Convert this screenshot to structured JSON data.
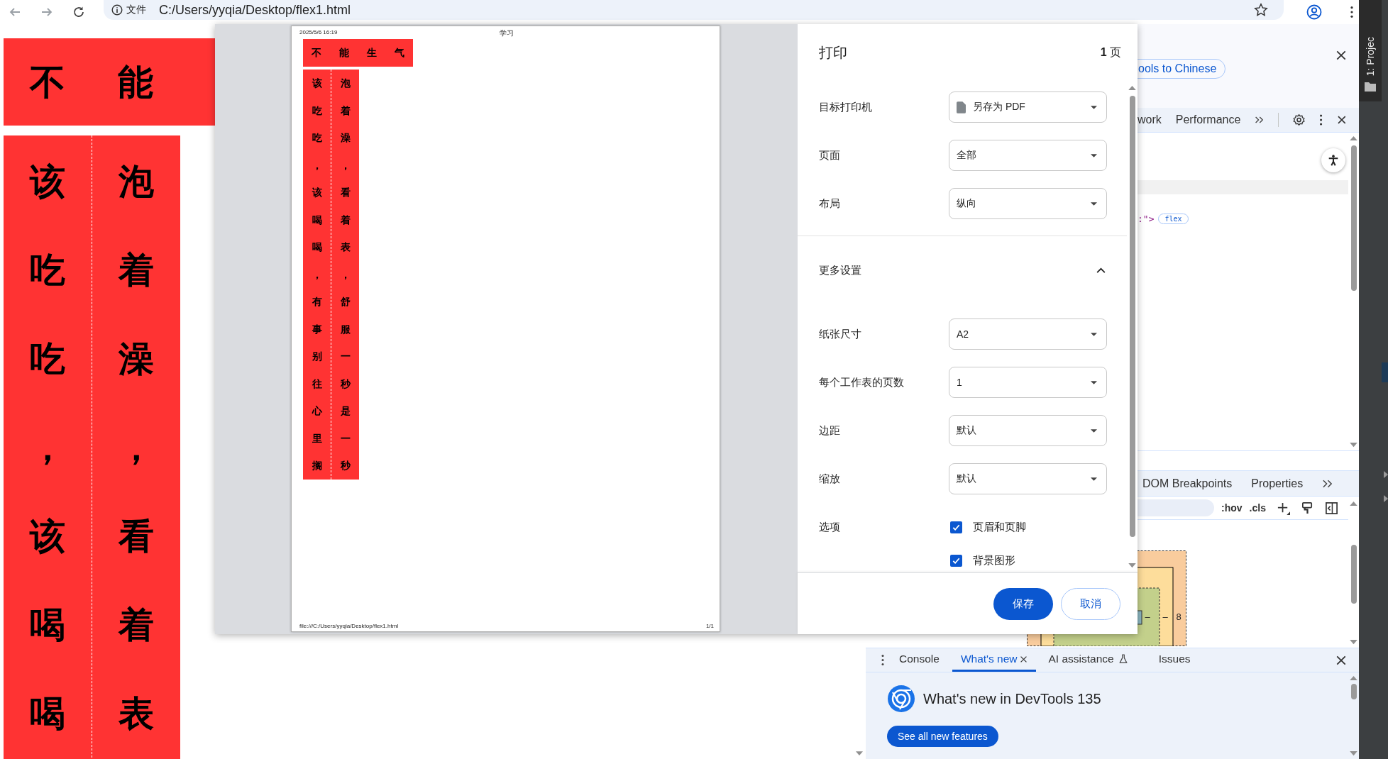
{
  "browser": {
    "scheme": "文件",
    "url": "C:/Users/yyqia/Desktop/flex1.html"
  },
  "page": {
    "banner": [
      "不",
      "能"
    ],
    "columns": [
      [
        "该",
        "吃",
        "吃",
        "，",
        "该",
        "喝",
        "喝"
      ],
      [
        "泡",
        "着",
        "澡",
        "，",
        "看",
        "着",
        "表"
      ]
    ]
  },
  "print_dialog": {
    "title": "打印",
    "page_count": "**1** 页",
    "preview": {
      "header_date": "2025/5/6 16:19",
      "header_title": "学习",
      "banner": [
        "不",
        "能",
        "生",
        "气"
      ],
      "columns": [
        [
          "该",
          "吃",
          "吃",
          "，",
          "该",
          "喝",
          "喝",
          "，",
          "有",
          "事",
          "别",
          "往",
          "心",
          "里",
          "搁"
        ],
        [
          "泡",
          "着",
          "澡",
          "，",
          "看",
          "着",
          "表",
          "，",
          "舒",
          "服",
          "一",
          "秒",
          "是",
          "一",
          "秒"
        ]
      ],
      "footer_url": "file:///C:/Users/yyqia/Desktop/flex1.html",
      "footer_page": "1/1"
    },
    "settings": [
      {
        "kind": "destination",
        "label": "目标打印机",
        "value": "另存为 PDF"
      },
      {
        "kind": "select",
        "label": "页面",
        "value": "全部"
      },
      {
        "kind": "select",
        "label": "布局",
        "value": "纵向"
      }
    ],
    "more_settings": {
      "label": "更多设置",
      "expanded": true
    },
    "advanced": [
      {
        "kind": "select",
        "label": "纸张尺寸",
        "value": "A2"
      },
      {
        "kind": "select",
        "label": "每个工作表的页数",
        "value": "1"
      },
      {
        "kind": "select",
        "label": "边距",
        "value": "默认"
      },
      {
        "kind": "select",
        "label": "缩放",
        "value": "默认"
      },
      {
        "kind": "checkboxes",
        "label": "选项",
        "options": [
          {
            "label": "页眉和页脚",
            "checked": true
          },
          {
            "label": "背景图形",
            "checked": true
          }
        ]
      }
    ],
    "buttons": [
      {
        "kind": "primary",
        "label": "保存"
      },
      {
        "kind": "secondary",
        "label": "取消"
      }
    ]
  },
  "devtools": {
    "language_pill": "ools to Chinese",
    "tabs": [
      {
        "label": "work",
        "selected": false
      },
      {
        "label": "Performance",
        "selected": false
      }
    ],
    "elements_snippet": ":\">",
    "badge": "flex",
    "sidebar_tabs": [
      {
        "label": "DOM Breakpoints",
        "selected": false
      },
      {
        "label": "Properties",
        "selected": false
      }
    ],
    "toolbar_buttons": [
      ":hov",
      ".cls"
    ],
    "box_model_values": [
      "–",
      "–",
      "8"
    ],
    "drawer": {
      "tabs": [
        {
          "label": "Console",
          "selected": false,
          "experimental": false
        },
        {
          "label": "What's new",
          "selected": true,
          "experimental": false
        },
        {
          "label": "AI assistance",
          "selected": false,
          "experimental": true
        },
        {
          "label": "Issues",
          "selected": false,
          "experimental": false
        }
      ],
      "heading": "What's new in DevTools 135",
      "button": "See all new features"
    }
  },
  "ide": {
    "tool_window": "1: Projec"
  }
}
